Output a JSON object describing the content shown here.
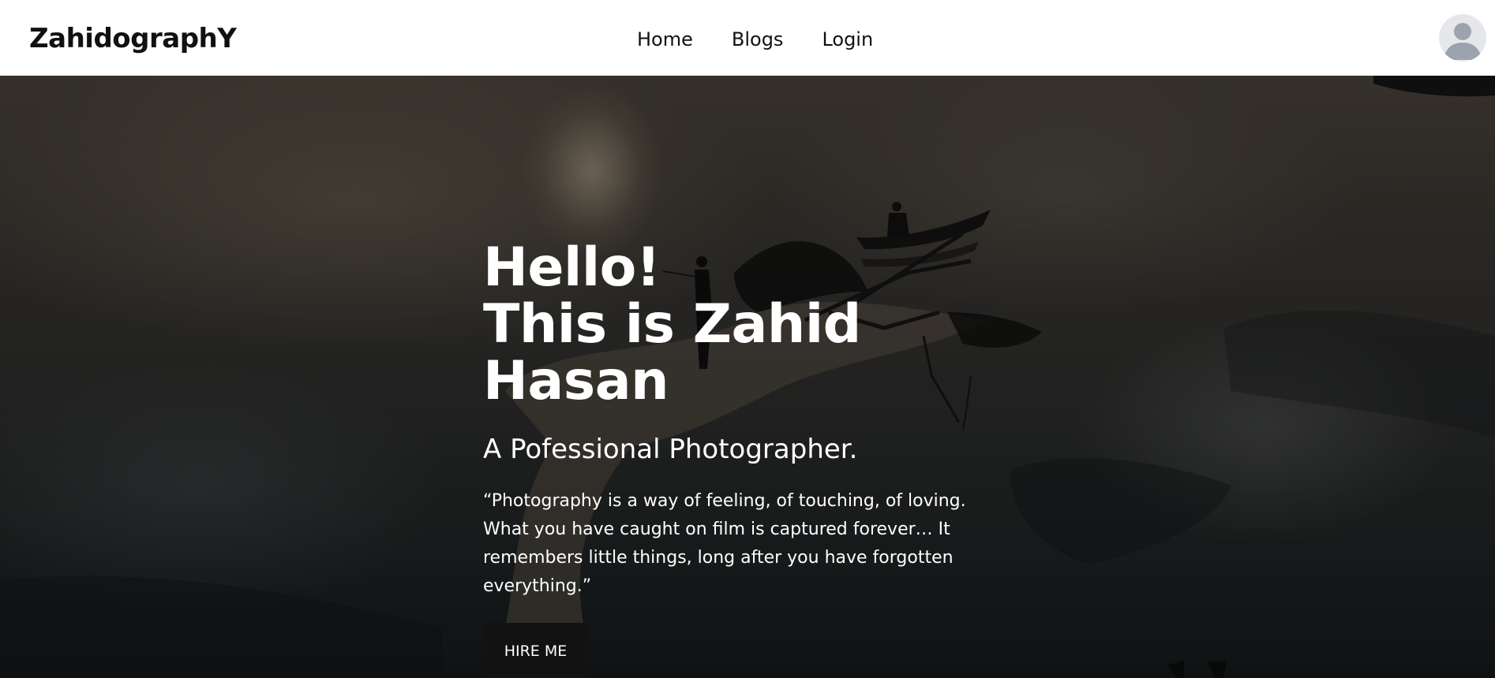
{
  "navbar": {
    "brand": "ZahidographY",
    "links": [
      "Home",
      "Blogs",
      "Login"
    ],
    "avatar_icon": "user-avatar-icon"
  },
  "hero": {
    "greeting": "Hello!",
    "name_line": "This is Zahid Hasan",
    "subtitle": "A Pofessional Photographer.",
    "quote": "“Photography is a way of feeling, of touching, of loving. What you have caught on film is captured forever… It remembers little things, long after you have forgotten everything.”",
    "cta_label": "HIRE ME"
  },
  "colors": {
    "nav_background": "#ffffff",
    "text_dark": "#111111",
    "hero_text": "#ffffff",
    "button_background": "#121212"
  }
}
